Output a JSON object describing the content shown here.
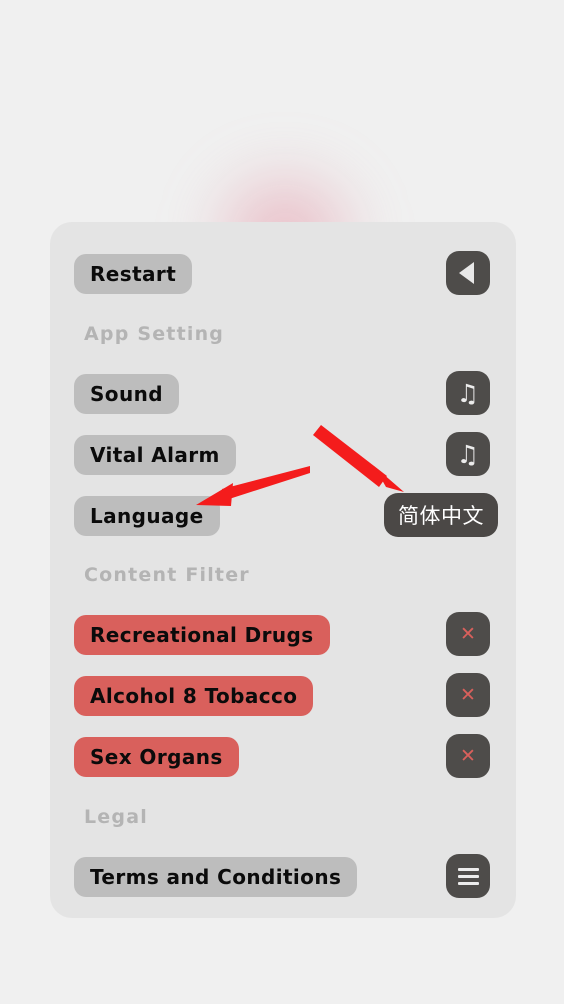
{
  "screen": {
    "background_color": "#f0f0f0",
    "card_color": "#e4e4e4",
    "accent_red": "#d9605c",
    "dark_control": "#4e4c4a",
    "gray_pill": "#bdbdbd",
    "section_label_color": "#b4b4b4",
    "annotation_arrow_color": "#f41c1c"
  },
  "card": {
    "top_row": {
      "label": "Restart",
      "control_icon": "back-triangle-icon"
    },
    "sections": [
      {
        "title": "App Setting",
        "rows": [
          {
            "label": "Sound",
            "control_icon": "music-note-icon",
            "control_type": "icon"
          },
          {
            "label": "Vital Alarm",
            "control_icon": "music-note-icon",
            "control_type": "icon"
          },
          {
            "label": "Language",
            "control_value": "简体中文",
            "control_type": "value"
          }
        ]
      },
      {
        "title": "Content Filter",
        "rows": [
          {
            "label": "Recreational Drugs",
            "control_icon": "close-x-icon",
            "control_type": "icon",
            "style": "red"
          },
          {
            "label": "Alcohol 8 Tobacco",
            "control_icon": "close-x-icon",
            "control_type": "icon",
            "style": "red"
          },
          {
            "label": "Sex Organs",
            "control_icon": "close-x-icon",
            "control_type": "icon",
            "style": "red"
          }
        ]
      },
      {
        "title": "Legal",
        "rows": [
          {
            "label": "Terms and Conditions",
            "control_icon": "hamburger-menu-icon",
            "control_type": "icon"
          }
        ]
      }
    ]
  },
  "icons": {
    "music_note": "♫",
    "close_x": "✕"
  },
  "annotations": [
    {
      "name": "arrow-to-language-pill",
      "points_to": "Language"
    },
    {
      "name": "arrow-to-language-value",
      "points_to": "简体中文"
    }
  ]
}
